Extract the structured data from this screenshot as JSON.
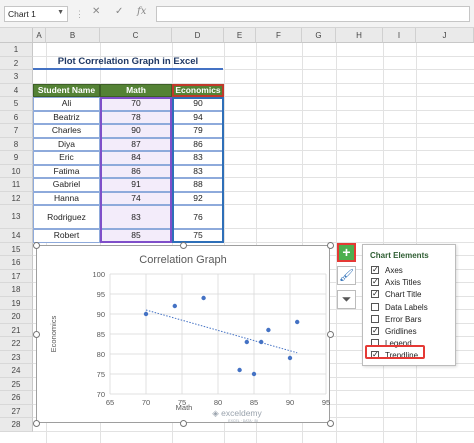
{
  "formula_bar": {
    "name_box": "Chart 1",
    "cancel_icon": "✕",
    "enter_icon": "✓",
    "fx_label": "fx",
    "formula": ""
  },
  "columns": [
    "A",
    "B",
    "C",
    "D",
    "E",
    "F",
    "G",
    "H",
    "I",
    "J"
  ],
  "rows": [
    "1",
    "2",
    "3",
    "4",
    "5",
    "6",
    "7",
    "8",
    "9",
    "10",
    "11",
    "12",
    "13",
    "14",
    "15",
    "16",
    "17",
    "18",
    "19",
    "20",
    "21",
    "22",
    "23",
    "24",
    "25",
    "26",
    "27",
    "28"
  ],
  "sheet_title": "Plot Correlation Graph in Excel",
  "table": {
    "headers": [
      "Student Name",
      "Math",
      "Economics"
    ],
    "rows": [
      [
        "Ali",
        "70",
        "90"
      ],
      [
        "Beatriz",
        "78",
        "94"
      ],
      [
        "Charles",
        "90",
        "79"
      ],
      [
        "Diya",
        "87",
        "86"
      ],
      [
        "Eric",
        "84",
        "83"
      ],
      [
        "Fatima",
        "86",
        "83"
      ],
      [
        "Gabriel",
        "91",
        "88"
      ],
      [
        "Hanna",
        "74",
        "92"
      ],
      [
        "Rodriguez",
        "83",
        "76"
      ],
      [
        "Robert",
        "85",
        "75"
      ]
    ]
  },
  "chart_data": {
    "type": "scatter",
    "title": "Correlation Graph",
    "xlabel": "Math",
    "ylabel": "Economics",
    "xlim": [
      65,
      95
    ],
    "ylim": [
      70,
      100
    ],
    "xticks": [
      "65",
      "70",
      "75",
      "80",
      "85",
      "90",
      "95"
    ],
    "yticks": [
      "70",
      "75",
      "80",
      "85",
      "90",
      "95",
      "100"
    ],
    "points": [
      [
        70,
        90
      ],
      [
        78,
        94
      ],
      [
        90,
        79
      ],
      [
        87,
        86
      ],
      [
        84,
        83
      ],
      [
        86,
        83
      ],
      [
        91,
        88
      ],
      [
        74,
        92
      ],
      [
        83,
        76
      ],
      [
        85,
        75
      ]
    ],
    "trendline": {
      "from": [
        70,
        91
      ],
      "to": [
        91,
        80.3
      ]
    },
    "grid": true,
    "marker_color": "#4472c4"
  },
  "chart_buttons": {
    "elements_icon": "+",
    "styles_icon": "🖌",
    "filters_icon": "⏷"
  },
  "chart_elements_panel": {
    "title": "Chart Elements",
    "items": [
      {
        "label": "Axes",
        "checked": true
      },
      {
        "label": "Axis Titles",
        "checked": true
      },
      {
        "label": "Chart Title",
        "checked": true
      },
      {
        "label": "Data Labels",
        "checked": false
      },
      {
        "label": "Error Bars",
        "checked": false
      },
      {
        "label": "Gridlines",
        "checked": true
      },
      {
        "label": "Legend",
        "checked": false
      },
      {
        "label": "Trendline",
        "checked": true
      }
    ]
  },
  "watermark": {
    "brand": "exceldemy",
    "tagline": "EXCEL · DATA · BI"
  },
  "colors": {
    "header_green": "#548235",
    "panel_title_green": "#2e5d32",
    "highlight_red": "#e53935",
    "accent_blue": "#4472c4"
  }
}
